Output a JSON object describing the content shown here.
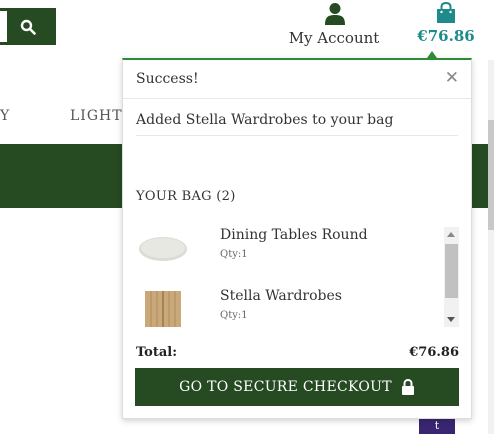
{
  "header": {
    "account_label": "My Account",
    "cart_total": "€76.86"
  },
  "nav": {
    "item_partial_left": "Y",
    "item_lighting": "LIGHTI"
  },
  "popup": {
    "title": "Success!",
    "close_symbol": "✕",
    "message": "Added Stella Wardrobes to your bag",
    "bag_label": "YOUR BAG (2)",
    "items": [
      {
        "name": "Dining Tables Round",
        "qty": "Qty:1"
      },
      {
        "name": "Stella Wardrobes",
        "qty": "Qty:1"
      }
    ],
    "total_label": "Total:",
    "total_value": "€76.86",
    "checkout_label": "GO TO SECURE CHECKOUT"
  },
  "bottom_badge": "t",
  "icons": {
    "search": "search-icon",
    "account": "user-icon",
    "cart": "shopping-bag-icon",
    "lock": "lock-icon",
    "close": "close-icon"
  },
  "colors": {
    "brand_green": "#264a22",
    "accent_teal": "#1e8a8a",
    "success_green": "#2f8a3a"
  }
}
